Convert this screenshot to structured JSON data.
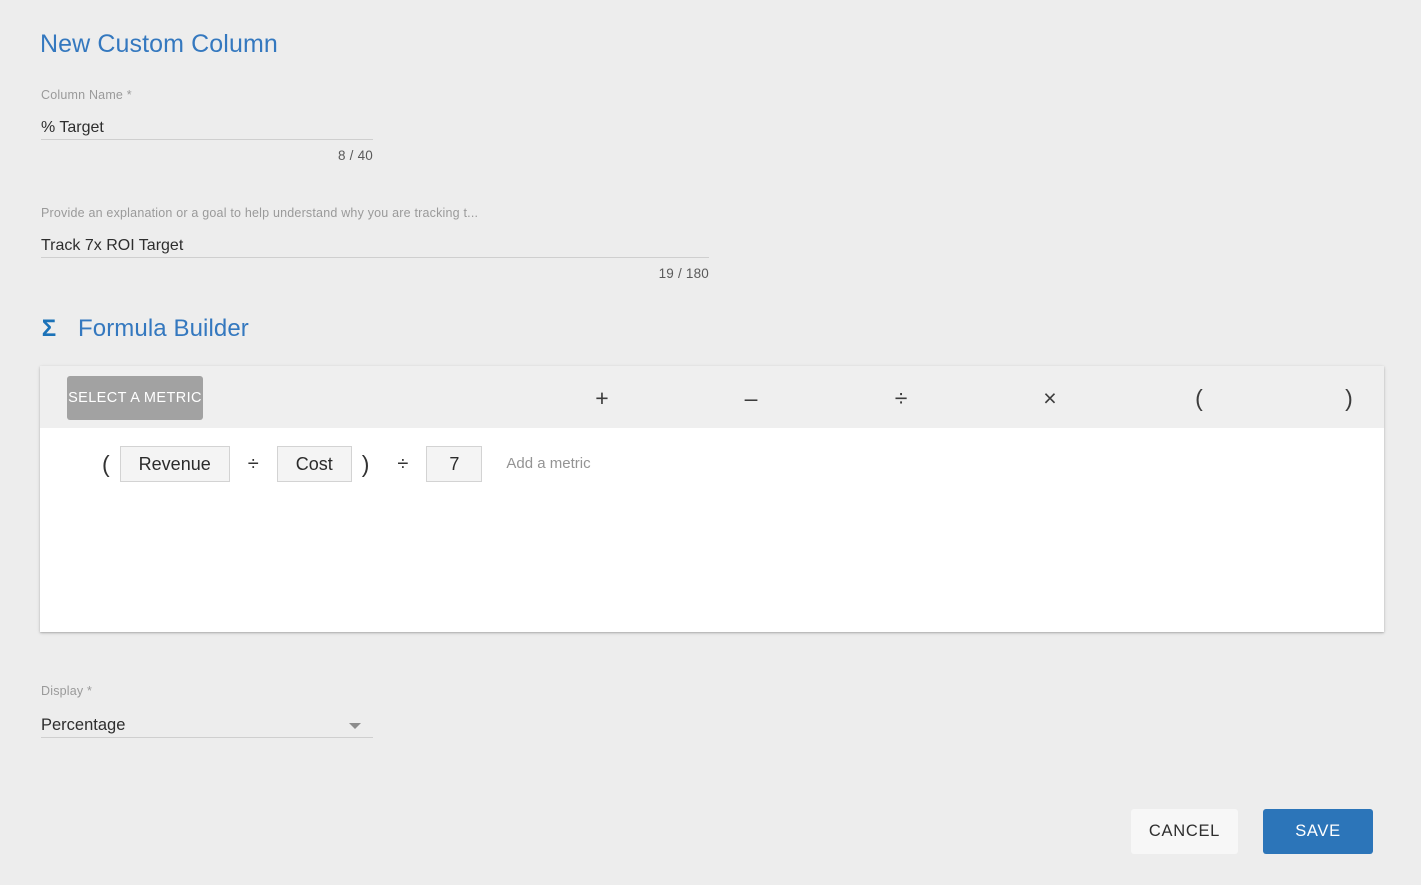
{
  "title": "New Custom Column",
  "fields": {
    "column_name": {
      "label": "Column Name *",
      "value": "% Target",
      "counter": "8 / 40"
    },
    "description": {
      "label": "Provide an explanation or a goal to help understand why you are tracking t...",
      "value": "Track 7x ROI Target",
      "counter": "19 / 180"
    },
    "display": {
      "label": "Display *",
      "value": "Percentage"
    }
  },
  "formula_builder": {
    "icon": "sigma-icon",
    "icon_glyph": "Σ",
    "heading": "Formula Builder",
    "select_metric_label": "SELECT A METRIC",
    "operators": [
      {
        "name": "plus",
        "glyph": "+"
      },
      {
        "name": "minus",
        "glyph": "–"
      },
      {
        "name": "divide",
        "glyph": "÷"
      },
      {
        "name": "multiply",
        "glyph": "×"
      },
      {
        "name": "open-paren",
        "glyph": "("
      },
      {
        "name": "close-paren",
        "glyph": ")"
      }
    ],
    "expression": {
      "open_paren": "(",
      "metric_1": "Revenue",
      "operator_1": "÷",
      "metric_2": "Cost",
      "close_paren": ")",
      "operator_2": "÷",
      "number": "7",
      "placeholder": "Add a metric"
    }
  },
  "footer": {
    "cancel_label": "CANCEL",
    "save_label": "SAVE"
  },
  "colors": {
    "accent_blue": "#3478bf",
    "save_blue": "#2c75b9",
    "sigma_blue": "#1b72b8",
    "page_background": "#ededed",
    "toolbar_gray": "#efefef",
    "select_metric_gray": "#a2a2a2"
  }
}
